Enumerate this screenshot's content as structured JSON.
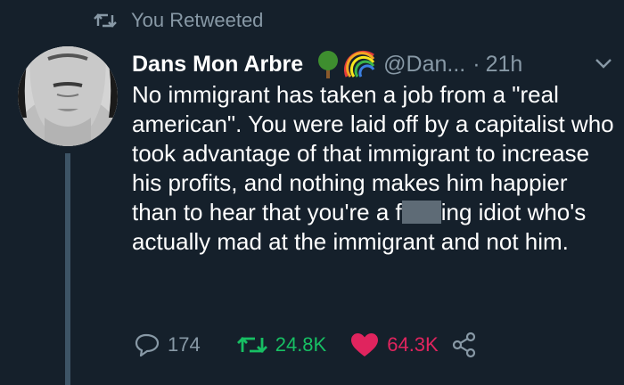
{
  "retweet_banner": {
    "icon": "retweet-icon",
    "text": "You Retweeted"
  },
  "tweet": {
    "display_name": "Dans Mon Arbre",
    "name_emojis": [
      "tree-emoji",
      "rainbow-emoji"
    ],
    "handle": "@Dan...",
    "separator": "·",
    "time": "21h",
    "text_before_redaction": "No immigrant has taken a job from a \"real american\".  You were laid off by a capitalist who took advantage of that immigrant to increase his profits, and nothing makes him happier than to hear that you're a f",
    "text_after_redaction": "ing idiot who's actually mad at the immigrant and not him.",
    "redaction_color": "#5e6b76"
  },
  "actions": {
    "replies": "174",
    "retweets": "24.8K",
    "likes": "64.3K"
  },
  "colors": {
    "background": "#15202b",
    "secondary_text": "#8899a6",
    "retweet_green": "#17bf63",
    "like_pink": "#e0245e",
    "thread_line": "#3d5466"
  }
}
